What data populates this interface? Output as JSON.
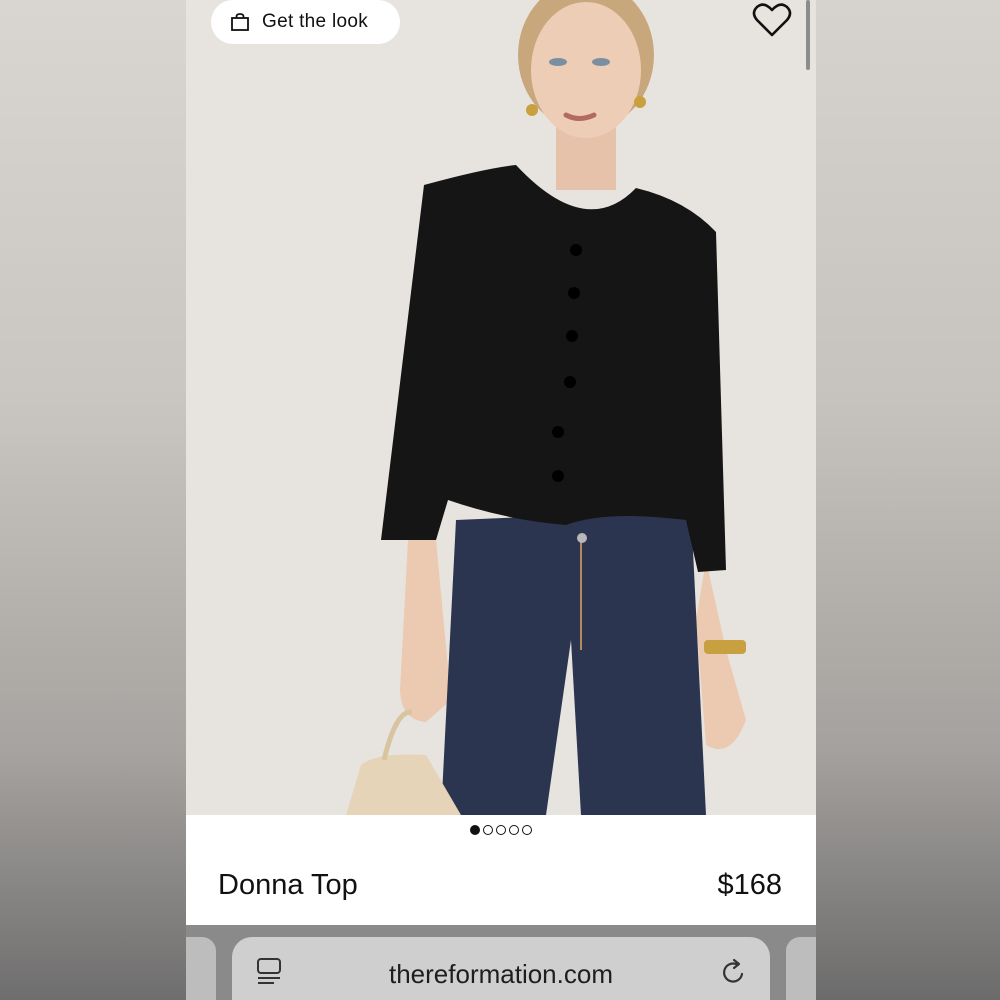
{
  "header": {
    "get_look_label": "Get the look",
    "get_look_icon": "shopping-bag-icon",
    "favorite_icon": "heart-icon"
  },
  "gallery": {
    "total_images": 5,
    "active_index": 0
  },
  "product": {
    "name": "Donna Top",
    "price": "$168"
  },
  "browser": {
    "url": "thereformation.com",
    "tabs_icon": "tabs-icon",
    "reload_icon": "reload-icon"
  },
  "colors": {
    "text": "#111111",
    "image_bg": "#e8e5e0",
    "browser_bar": "#8a8a8a"
  }
}
